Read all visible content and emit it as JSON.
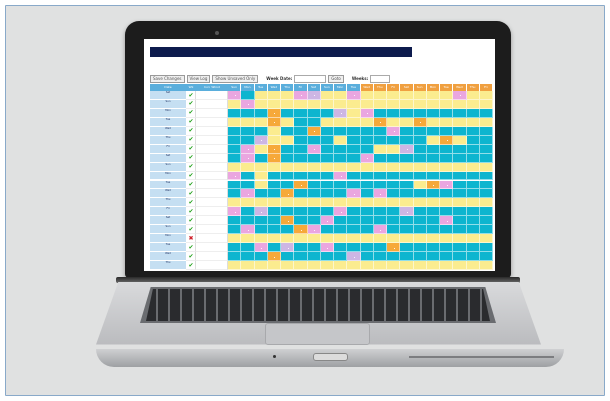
{
  "screen": {
    "top_links": [
      "",
      "",
      "",
      ""
    ],
    "toolbar": {
      "save_label": "Save Changes",
      "view_label": "View Log",
      "unsaved_label": "Show Unsaved Only",
      "week_label": "Week Date:",
      "goto_label": "Goto",
      "weeks_label": "Weeks:"
    },
    "columns": [
      "Date",
      "Wk",
      "Incl. Wknd"
    ],
    "days": [
      "Sun",
      "Mon",
      "Tue",
      "Wed",
      "Thu",
      "Fri",
      "Sat"
    ],
    "row_labels": [
      "Sat",
      "Sun",
      "Mon",
      "Tue",
      "Wed",
      "Thu",
      "Fri",
      "Sat",
      "Sun",
      "Mon",
      "Tue",
      "Wed",
      "Thu",
      "Fri",
      "Sat",
      "Sun",
      "Mon",
      "Tue",
      "Wed",
      "Thu"
    ],
    "row_dates": [
      "",
      "",
      "",
      "",
      "",
      "",
      "",
      "",
      "",
      "",
      "",
      "",
      "",
      "",
      "",
      "",
      "",
      "",
      "",
      ""
    ],
    "checks": [
      "tick",
      "tick",
      "tick",
      "tick",
      "tick",
      "tick",
      "tick",
      "tick",
      "tick",
      "tick",
      "tick",
      "tick",
      "tick",
      "tick",
      "tick",
      "tick",
      "cross",
      "tick",
      "tick",
      "tick"
    ]
  },
  "colors": {
    "cyan": "#0db5cf",
    "yellow": "#fbec8f",
    "pink": "#eaa6e0",
    "orange": "#f6a93a",
    "lavender": "#cdb6e4",
    "header_blue": "#5aaedc",
    "header_orange": "#f0a040",
    "title_bar": "#0d1b4d",
    "frame_border": "#89a9c9"
  },
  "pattern": [
    "PCYYYPLYYPYYYYYYYPYY",
    "YPYYYYYYYYYYYYYYYYYY",
    "CCCOCCCCLYPCCCCCCCCC",
    "YYYOYCCYYYYOYYOYYYYY",
    "CCCYCCOCCCCCPCCCCCCC",
    "CCLYYCCCYCCCCCCYOYCC",
    "CPYOCCPCCCCYYLCCCCCC",
    "CPCOCCCCCCPCCCCCCCCC",
    "YYYYYYYYYYYYYYYYYYYY",
    "PCYCCCCCPCCCCCCCCCCC",
    "CCYCCOCCCCCCCCYOPCCC",
    "CPCCOCCCCPCPCCCCCCCC",
    "YYYYYYYYYYYYYYYYYYYY",
    "PCLCCCCCPCCCCLCCCCCC",
    "CCCCOCCPCCCCCCCCPCCC",
    "CPCCCOPCCCCPCCCCCCCC",
    "YYYYYYYYYYYYYYYYYYYY",
    "CCPCLCCPCCCCOCCCCCCC",
    "CCCOCCCCCLCCCCCCCCCC",
    "YYYYYYYYYYYYYYYYYYYY"
  ]
}
